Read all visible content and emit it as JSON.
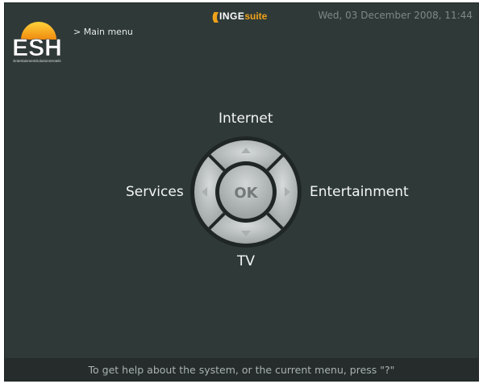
{
  "header": {
    "logo_text": "ESH",
    "logo_subtext": "EntertainmentSolutionsHotels",
    "breadcrumb": "> Main menu",
    "brand_part1": "INGE",
    "brand_part2": "suite",
    "datetime": "Wed, 03 December 2008, 11:44"
  },
  "menu": {
    "up": "Internet",
    "left": "Services",
    "right": "Entertainment",
    "down": "TV",
    "ok_label": "OK"
  },
  "footer": {
    "help_text": "To get help about the system, or the current menu, press \"?\""
  },
  "colors": {
    "background": "#2f3a38",
    "dpad_fill": "#b8bebd",
    "brand_accent": "#f0a21a"
  }
}
